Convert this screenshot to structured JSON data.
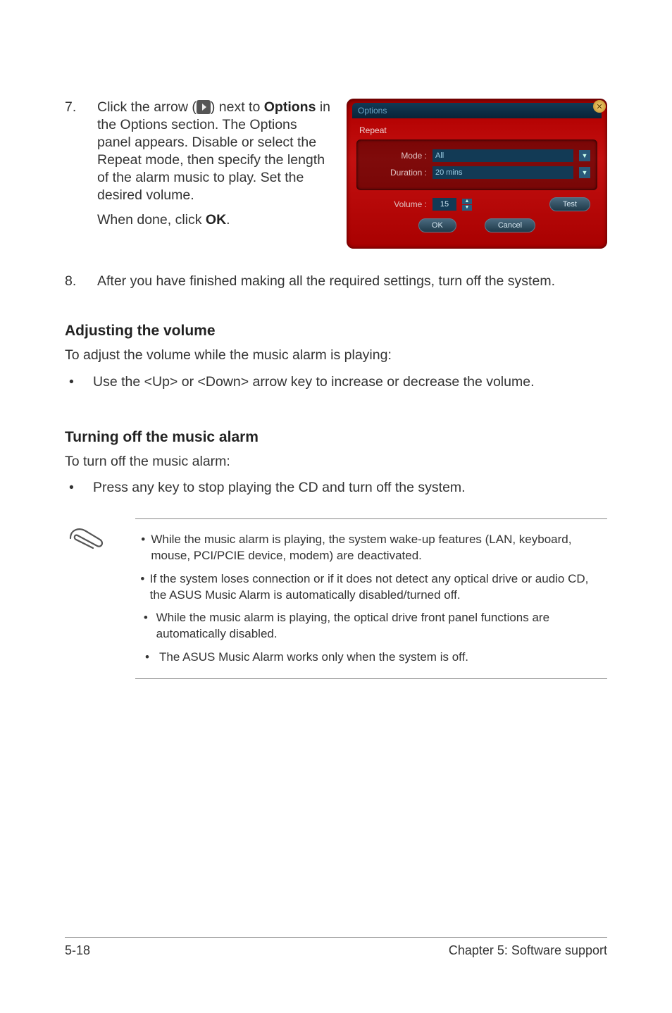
{
  "step7": {
    "number": "7.",
    "text_before_icon": "Click the arrow (",
    "text_after_icon": ") next to ",
    "options_word": "Options",
    "rest": " in the Options section. The Options panel appears. Disable or select the Repeat mode, then specify the length of the alarm music to play. Set the desired volume.",
    "when_done_pre": "When done, click ",
    "ok_word": "OK",
    "when_done_post": "."
  },
  "options_panel": {
    "title": "Options",
    "section_label": "Repeat",
    "mode_label": "Mode :",
    "mode_value": "All",
    "duration_label": "Duration :",
    "duration_value": "20 mins",
    "volume_label": "Volume :",
    "volume_value": "15",
    "test_btn": "Test",
    "ok_btn": "OK",
    "cancel_btn": "Cancel"
  },
  "step8": {
    "number": "8.",
    "text": "After you have finished making all the required settings, turn off the system."
  },
  "adjust": {
    "heading": "Adjusting the volume",
    "intro": "To adjust the volume while the music alarm is playing:",
    "bullet": "Use the  <Up> or <Down> arrow key to increase or decrease the volume."
  },
  "turnoff": {
    "heading": "Turning off the music alarm",
    "intro": "To turn off the music alarm:",
    "bullet": "Press any key to stop playing the CD and turn off the system."
  },
  "notes": {
    "n1": "While the music alarm is playing, the system wake-up features (LAN, keyboard, mouse, PCI/PCIE device, modem) are deactivated.",
    "n2": "If the system loses connection or if it does not detect any optical drive or audio CD, the ASUS Music Alarm is automatically disabled/turned off.",
    "n3": "While the music alarm is playing, the optical drive front panel functions are automatically disabled.",
    "n4": "The ASUS Music Alarm works only when the system is off."
  },
  "footer": {
    "left": "5-18",
    "right": "Chapter 5: Software support"
  }
}
